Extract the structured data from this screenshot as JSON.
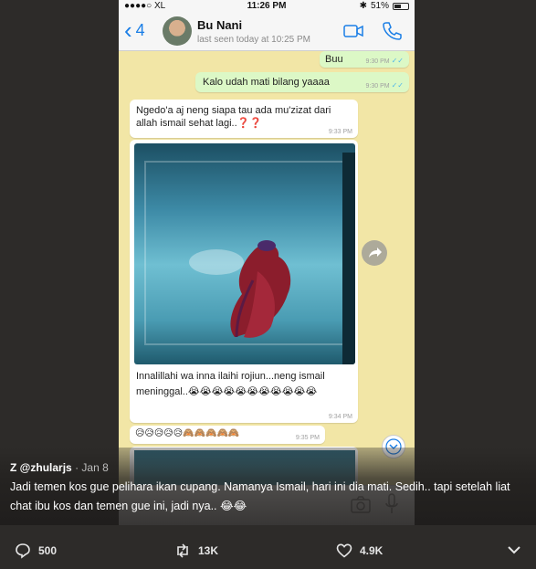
{
  "status_bar": {
    "carrier": "●●●●○ XL",
    "time": "11:26 PM",
    "battery": "51%",
    "battery_level": 0.51
  },
  "chat_header": {
    "back_count": "4",
    "contact_name": "Bu Nani",
    "last_seen": "last seen today at 10:25 PM"
  },
  "messages": [
    {
      "text": "Buu",
      "time": "9:30 PM",
      "type": "out"
    },
    {
      "text": "Kalo udah mati bilang yaaaa",
      "time": "9:30 PM",
      "type": "out"
    },
    {
      "text": "Ngedo'a aj neng siapa tau ada mu'zizat dari allah ismail sehat lagi..❓❓",
      "time": "9:33 PM",
      "type": "in"
    },
    {
      "text": "Innalillahi wa inna ilaihi rojiun...neng ismail meninggal..😭😭😭😭😭😭😭😭😭😭😭",
      "time": "9:34 PM",
      "type": "in"
    },
    {
      "text": "😥😥😥😥😥🙈🙈🙈🙈🙈",
      "time": "9:35 PM",
      "type": "in"
    }
  ],
  "tweet": {
    "author": "Z @zhularjs",
    "date": "· Jan 8",
    "text": "Jadi temen kos gue pelihara ikan cupang. Namanya Ismail, hari ini dia mati. Sedih.. tapi setelah liat chat ibu kos dan temen gue ini, jadi nya.. 😂😂"
  },
  "actions": {
    "replies": "500",
    "retweets": "13K",
    "likes": "4.9K"
  },
  "icons": [
    "wifi-icon",
    "bluetooth-icon",
    "battery-icon",
    "back-chevron-icon",
    "video-call-icon",
    "phone-call-icon",
    "share-icon",
    "scroll-down-icon",
    "reply-icon",
    "retweet-icon",
    "like-icon",
    "caret-down-icon"
  ]
}
